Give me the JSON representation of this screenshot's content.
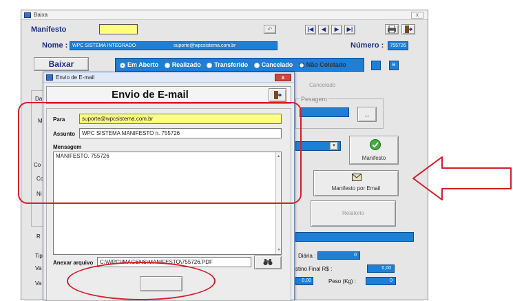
{
  "main_window": {
    "title": "Baixa",
    "close_glyph": "x",
    "manifesto_label": "Manifesto",
    "manifesto_value": "",
    "nome_label": "Nome :",
    "nome_value": "WPC SISTEMA INTEGRADO",
    "email_value": "suporte@wpcsistema.com.br",
    "numero_label": "Número :",
    "numero_value": "755726",
    "baixar_label": "Baixar",
    "status_options": [
      {
        "label": "Em Aberto",
        "selected": true
      },
      {
        "label": "Realizado",
        "selected": false
      },
      {
        "label": "Transferido",
        "selected": false
      },
      {
        "label": "Cancelado",
        "selected": false
      },
      {
        "label": "Não Coletado",
        "selected": false
      }
    ],
    "cancelado_label": "Cancelado",
    "pesagem_label": "Pesagem",
    "pesagem_btn": "...",
    "manifesto_btn": "Manifesto",
    "manifesto_email_btn": "Manifesto por Email",
    "relatorio_btn": "Relatorio",
    "diaria_label": "Diária :",
    "diaria_value": "0",
    "custo_label": "stino Final R$ :",
    "custo_value": "0,00",
    "val_left_value": "0,00",
    "peso_label": "Peso (Kg) :",
    "peso_value": "0",
    "left_fragments": [
      "Da",
      "Ma",
      "Co",
      "Co",
      "Ni",
      "R",
      "Tip",
      "Va",
      "Va"
    ]
  },
  "dialog": {
    "title": "Envio de E-mail",
    "header": "Envio de  E-mail",
    "para_label": "Para",
    "para_value": "suporte@wpcsistema.com.br",
    "assunto_label": "Assunto",
    "assunto_value": "WPC SISTEMA MANIFESTO n. 755726",
    "mensagem_label": "Mensagem",
    "mensagem_value": "MANIFESTO. 755726",
    "anexar_label": "Anexar arquivo",
    "anexar_value": "C:\\WPC\\IMAGENS\\MANIFESTO\\755726.PDF",
    "send_label": ""
  },
  "colors": {
    "accent_blue": "#1d7fd6",
    "label_navy": "#1b2f88",
    "highlight_yellow": "#ffff80",
    "annotation_red": "#d41e2c"
  },
  "icons": [
    "window-icon",
    "exit-door-icon",
    "print-icon",
    "check-green-icon",
    "envelope-icon",
    "binoculars-icon",
    "arrow-pointer-icon"
  ]
}
